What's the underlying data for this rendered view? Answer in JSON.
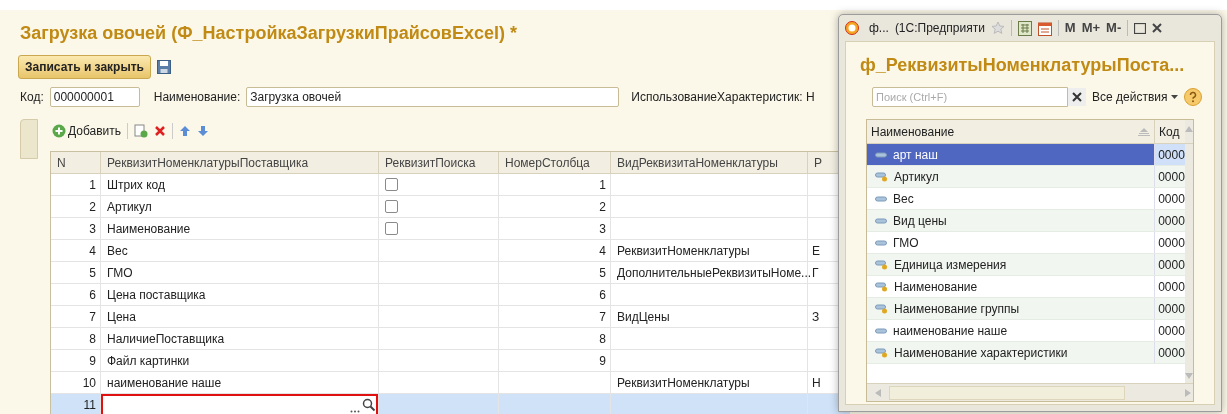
{
  "form": {
    "title": "Загрузка овочей (Ф_НастройкаЗагрузкиПрайсовExcel) *",
    "save_close_button": "Записать и закрыть",
    "fields": [
      {
        "label": "Код:",
        "value": "000000001"
      },
      {
        "label": "Наименование:",
        "value": "Загрузка овочей"
      }
    ],
    "cut_label": "ИспользованиеХарактеристик: Н",
    "toolbar": {
      "add_button": "Добавить"
    },
    "table": {
      "columns": [
        "N",
        "РеквизитНоменклатурыПоставщика",
        "РеквизитПоиска",
        "НомерСтолбца",
        "ВидРеквизитаНоменклатуры",
        "Р"
      ],
      "rows": [
        {
          "n": "1",
          "name": "Штрих код",
          "search_checked": false,
          "col": "1",
          "selected": false
        },
        {
          "n": "2",
          "name": "Артикул",
          "search_checked": false,
          "col": "2",
          "selected": false
        },
        {
          "n": "3",
          "name": "Наименование",
          "search_checked": false,
          "col": "3",
          "selected": false
        },
        {
          "n": "4",
          "name": "Вес",
          "col": "4",
          "kind": "РеквизитНоменклатуры",
          "column_6": "Е",
          "selected": false
        },
        {
          "n": "5",
          "name": "ГМО",
          "col": "5",
          "kind": "ДополнительныеРеквизитыНоме...",
          "column_6": "Г",
          "selected": false
        },
        {
          "n": "6",
          "name": "Цена поставщика",
          "col": "6",
          "selected": false
        },
        {
          "n": "7",
          "name": "Цена",
          "col": "7",
          "kind": "ВидЦены",
          "column_6": "З",
          "selected": false
        },
        {
          "n": "8",
          "name": "НаличиеПоставщика",
          "col": "8",
          "selected": false
        },
        {
          "n": "9",
          "name": "Файл картинки",
          "col": "9",
          "selected": false
        },
        {
          "n": "10",
          "name": "наименование наше",
          "kind": "РеквизитНоменклатуры",
          "column_6": "Н",
          "selected": false
        },
        {
          "n": "11",
          "selected": true,
          "editing": true
        }
      ]
    }
  },
  "popup": {
    "window_title": "ф...",
    "app_title": "(1С:Предприяти",
    "memory_buttons": [
      "M",
      "M+",
      "M-"
    ],
    "heading": "ф_РеквизитыНоменклатурыПоста...",
    "search": {
      "placeholder": "Поиск (Ctrl+F)"
    },
    "all_actions": "Все действия",
    "columns": [
      "Наименование",
      "Код"
    ],
    "rows": [
      {
        "name": "арт наш",
        "code": "0000",
        "kind": "plain",
        "selected": true
      },
      {
        "name": "Артикул",
        "code": "0000",
        "kind": "additional",
        "selected": false
      },
      {
        "name": "Вес",
        "code": "0000",
        "kind": "plain",
        "selected": false
      },
      {
        "name": "Вид цены",
        "code": "0000",
        "kind": "plain",
        "selected": false
      },
      {
        "name": "ГМО",
        "code": "0000",
        "kind": "plain",
        "selected": false
      },
      {
        "name": "Единица измерения",
        "code": "0000",
        "kind": "additional",
        "selected": false
      },
      {
        "name": "Наименование",
        "code": "0000",
        "kind": "additional",
        "selected": false
      },
      {
        "name": "Наименование группы",
        "code": "0000",
        "kind": "additional",
        "selected": false
      },
      {
        "name": "наименование наше",
        "code": "0000",
        "kind": "plain",
        "selected": false
      },
      {
        "name": "Наименование характеристики",
        "code": "0000",
        "kind": "additional",
        "selected": false
      }
    ]
  }
}
